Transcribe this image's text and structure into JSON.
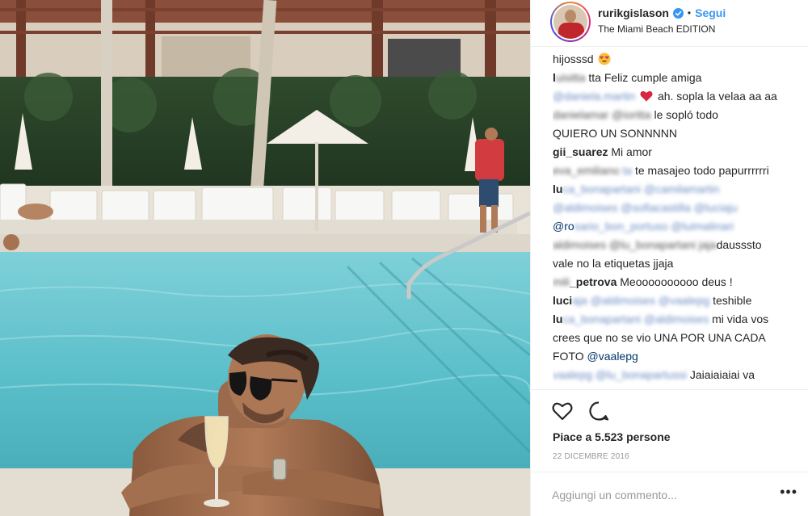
{
  "post": {
    "username": "rurikgislason",
    "verified_icon": "verified-badge-icon",
    "separator": "•",
    "follow_label": "Segui",
    "location": "The Miami Beach EDITION"
  },
  "comments": [
    {
      "text": "hijosssd",
      "emoji": "heart-eyes-emoji"
    },
    {
      "user_visible": "l",
      "user_blurred": "uisitta",
      "text": "tta Feliz cumple amiga"
    },
    {
      "user_blurred": "@daniela.martin",
      "emoji": "red-heart-emoji",
      "text": "ah. sopla la velaa aa aa"
    },
    {
      "user_blurred": "danielamar @ioritta",
      "text": "le sopló todo",
      "text_line2": "QUIERO UN SONNNNN"
    },
    {
      "user": "gii_suarez",
      "text": "Mi amor"
    },
    {
      "user_blurred": "eva_emiliano",
      "text_blurred": "ta",
      "text": "te masajeo todo papurrrrrri"
    },
    {
      "user_visible": "lu",
      "user_blurred": "ca_bonapartani @camilamartin",
      "line2_blurred": "@aldimoises @sofiacastilla @luciaju",
      "line3_visible": "@ro",
      "line3_blurred": "sario_bon_portuso @luimalinari"
    },
    {
      "user_blurred": "aldimoises @lu_bonapartani",
      "text_blurred": "jaja",
      "text": "dausssto",
      "text_line2": "vale no la etiquetas jjaja"
    },
    {
      "user_visible_blurred": "mili",
      "user": "_petrova",
      "text": "Meoooooooooo deus !"
    },
    {
      "user_visible": "luci",
      "user_blurred": "aja @aldimoises @vaalepg",
      "text": "teshible"
    },
    {
      "user_visible": "lu",
      "user_blurred": "ca_bonapartani @aldimoises",
      "text": "mi vida vos",
      "text_line2": "crees que no se vio UNA POR UNA CADA",
      "text_line3": "FOTO",
      "mention": "@vaalepg"
    },
    {
      "user_blurred": "vaalepg @lu_bonapartussi",
      "text": "Jaiaiaiaiai va"
    }
  ],
  "actions": {
    "like_icon": "heart-outline-icon",
    "comment_icon": "comment-bubble-icon"
  },
  "likes_text": "Piace a 5.523 persone",
  "date": "22 DICEMBRE 2016",
  "add_comment": {
    "placeholder": "Aggiungi un commento...",
    "more_label": "•••"
  }
}
